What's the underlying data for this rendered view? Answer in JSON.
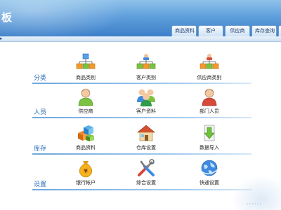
{
  "header": {
    "title": "板",
    "tabs": [
      "商品资料",
      "客户",
      "供应商",
      "库存查询",
      ""
    ]
  },
  "sections": [
    {
      "label": "分类",
      "items": [
        {
          "label": "商品类别",
          "icon": "tree-diagram-icon"
        },
        {
          "label": "客户类别",
          "icon": "people-tree-icon"
        },
        {
          "label": "供应商类别",
          "icon": "supplier-tree-icon"
        }
      ]
    },
    {
      "label": "人员",
      "items": [
        {
          "label": "供应商",
          "icon": "supplier-person-icon"
        },
        {
          "label": "客户资料",
          "icon": "customer-group-icon"
        },
        {
          "label": "部门人员",
          "icon": "staff-person-icon"
        }
      ]
    },
    {
      "label": "库存",
      "items": [
        {
          "label": "商品资料",
          "icon": "product-boxes-icon"
        },
        {
          "label": "仓库设置",
          "icon": "warehouse-house-icon"
        },
        {
          "label": "数据导入",
          "icon": "import-arrow-icon"
        }
      ]
    },
    {
      "label": "设置",
      "items": [
        {
          "label": "银行帐户",
          "icon": "money-bag-icon"
        },
        {
          "label": "综合设置",
          "icon": "tools-icon"
        },
        {
          "label": "快通设置",
          "icon": "globe-icon"
        }
      ]
    }
  ],
  "colors": {
    "header": "#3d7fc9",
    "section_label": "#2b6fb8",
    "divider": "#6da7dd"
  }
}
